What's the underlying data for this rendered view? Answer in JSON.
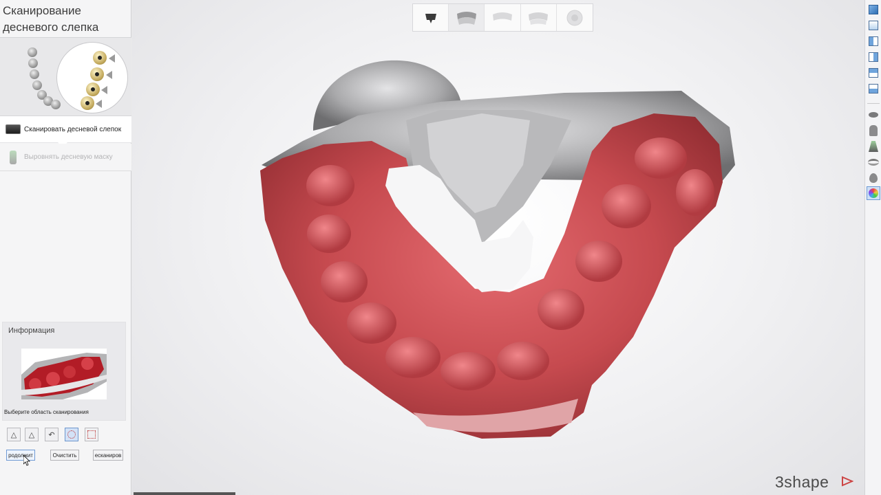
{
  "panel": {
    "title": "Сканирование десневого слепка"
  },
  "steps": [
    {
      "label": "Сканировать десневой слепок",
      "icon": "scanner-icon",
      "state": "active"
    },
    {
      "label": "Выровнять десневую маску",
      "icon": "gingiva-mask-icon",
      "state": "disabled"
    }
  ],
  "info": {
    "title": "Информация",
    "hint": "Выберите область сканирования"
  },
  "tools": [
    {
      "icon": "lasso-add-icon",
      "active": false
    },
    {
      "icon": "lasso-remove-icon",
      "active": false
    },
    {
      "icon": "undo-icon",
      "active": false
    },
    {
      "icon": "circle-select-icon",
      "active": true
    },
    {
      "icon": "rectangle-select-icon",
      "active": false
    }
  ],
  "actions": {
    "continue": "родолжит",
    "clear": "Очистить",
    "rescan": "есканиров"
  },
  "workflow_steps": [
    {
      "icon": "scanner-step-icon",
      "state": "done"
    },
    {
      "icon": "gingiva-impression-step-icon",
      "state": "current"
    },
    {
      "icon": "upper-model-step-icon",
      "state": "pending"
    },
    {
      "icon": "lower-model-step-icon",
      "state": "pending"
    },
    {
      "icon": "bite-step-icon",
      "state": "pending"
    }
  ],
  "right_toolbar": [
    "view-3d-icon",
    "view-front-icon",
    "view-left-icon",
    "view-right-icon",
    "view-back-icon",
    "view-bottom-icon",
    "gingiva-visibility-icon",
    "tooth-visibility-icon",
    "scan-visibility-icon",
    "model-visibility-icon",
    "marker-icon",
    "color-texture-icon"
  ],
  "right_toolbar_active": "color-texture-icon",
  "logo": "3shape",
  "colors": {
    "accent": "#6b99d3",
    "gingiva": "#c64a4f",
    "stone": "#a9a9ab"
  }
}
